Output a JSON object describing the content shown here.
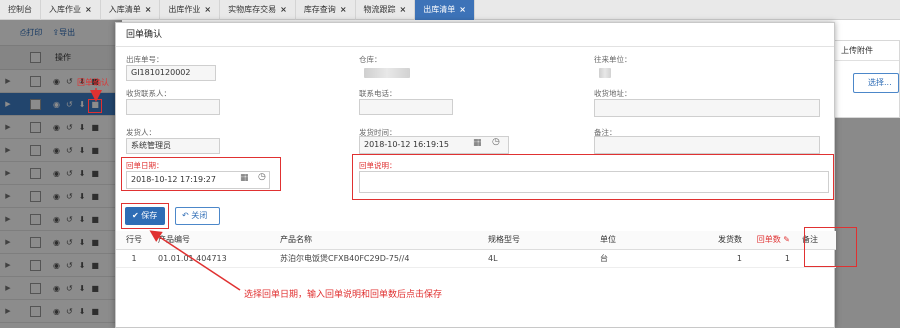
{
  "tabs": [
    {
      "label": "控制台",
      "closable": false
    },
    {
      "label": "入库作业",
      "closable": true
    },
    {
      "label": "入库清单",
      "closable": true
    },
    {
      "label": "出库作业",
      "closable": true
    },
    {
      "label": "实物库存交易",
      "closable": true
    },
    {
      "label": "库存查询",
      "closable": true
    },
    {
      "label": "物流跟踪",
      "closable": true
    },
    {
      "label": "出库清单",
      "closable": true,
      "active": true
    }
  ],
  "tab_close_glyph": "×",
  "background": {
    "print_label": "打印",
    "export_label": "导出",
    "ops_header": "操作"
  },
  "attachments": {
    "title": "上传附件",
    "select_label": "选择..."
  },
  "modal": {
    "title": "回单确认",
    "fields": {
      "outbound_no": {
        "label": "出库单号：",
        "value": "GI1810120002"
      },
      "warehouse": {
        "label": "仓库："
      },
      "partner": {
        "label": "往来单位："
      },
      "contact": {
        "label": "收货联系人：",
        "value": ""
      },
      "phone": {
        "label": "联系电话：",
        "value": ""
      },
      "address": {
        "label": "收货地址：",
        "value": ""
      },
      "shipper": {
        "label": "发货人：",
        "value": "系统管理员"
      },
      "ship_time": {
        "label": "发货时间：",
        "value": "2018-10-12 16:19:15"
      },
      "remark": {
        "label": "备注：",
        "value": ""
      },
      "receipt_date": {
        "label": "回单日期：",
        "value": "2018-10-12 17:19:27"
      },
      "receipt_note": {
        "label": "回单说明：",
        "value": ""
      }
    },
    "save_label": "保存",
    "close_label": "关闭",
    "table": {
      "headers": {
        "row_no": "行号",
        "product_code": "产品编号",
        "product_name": "产品名称",
        "spec": "规格型号",
        "unit": "单位",
        "qty": "发货数",
        "receipt_qty": "回单数",
        "remark": "备注"
      },
      "rows": [
        {
          "row_no": "1",
          "product_code": "01.01.01.404713",
          "product_name": "苏泊尔电饭煲CFXB40FC29D-75//4",
          "spec": "4L",
          "unit": "台",
          "qty": "1",
          "receipt_qty": "1",
          "remark": ""
        }
      ]
    }
  },
  "annotations": {
    "left_note": "回单确认",
    "bottom_note": "选择回单日期，输入回单说明和回单数后点击保存"
  },
  "colors": {
    "accent": "#3d73b8",
    "highlight": "#e03131"
  }
}
